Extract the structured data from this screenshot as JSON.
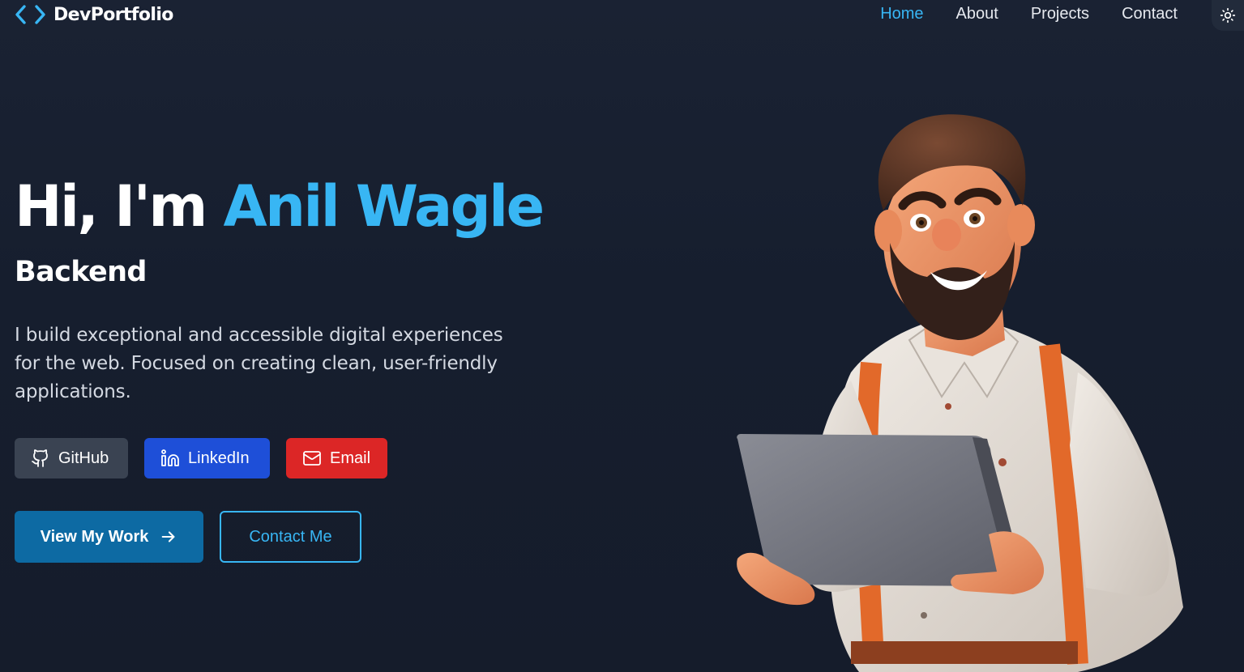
{
  "header": {
    "brand": "DevPortfolio",
    "nav": [
      {
        "label": "Home",
        "active": true
      },
      {
        "label": "About",
        "active": false
      },
      {
        "label": "Projects",
        "active": false
      },
      {
        "label": "Contact",
        "active": false
      }
    ],
    "theme_toggle_icon": "sun-icon"
  },
  "hero": {
    "greeting": "Hi, I'm",
    "name": "Anil Wagle",
    "role": "Backend",
    "bio": "I build exceptional and accessible digital experiences for the web. Focused on creating clean, user-friendly applications."
  },
  "social": [
    {
      "label": "GitHub",
      "icon": "github-icon",
      "color": "#3a4352"
    },
    {
      "label": "LinkedIn",
      "icon": "linkedin-icon",
      "color": "#1e4fd8"
    },
    {
      "label": "Email",
      "icon": "mail-icon",
      "color": "#dc2626"
    }
  ],
  "cta": {
    "primary": "View My Work",
    "primary_icon": "arrow-right-icon",
    "secondary": "Contact Me"
  },
  "colors": {
    "background": "#161e2e",
    "accent": "#38b6f4",
    "primary_button": "#0d6aa3"
  },
  "illustration": "3d-developer-avatar-illustration"
}
